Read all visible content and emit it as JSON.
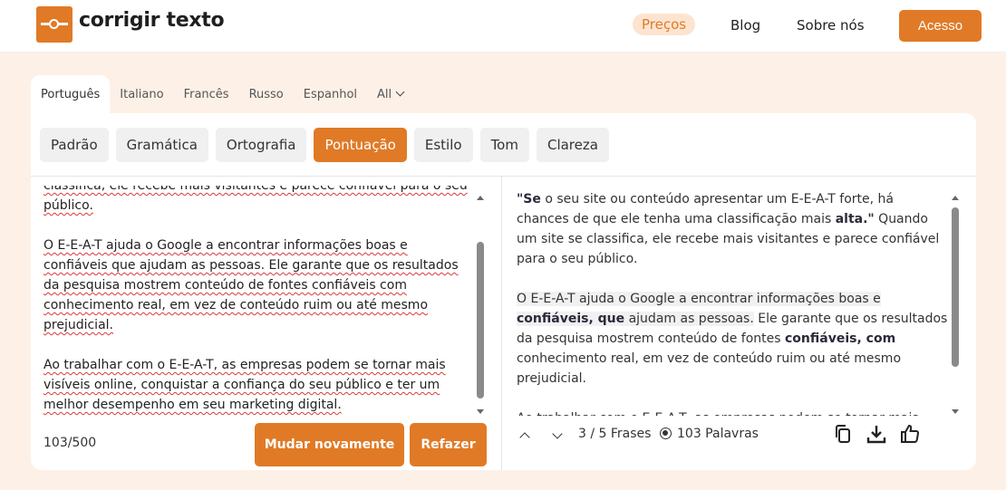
{
  "header": {
    "logo_text": "corrigir texto",
    "nav": {
      "precos": "Preços",
      "blog": "Blog",
      "sobre": "Sobre nós"
    },
    "acesso_label": "Acesso"
  },
  "languages": {
    "items": [
      "Português",
      "Italiano",
      "Francês",
      "Russo",
      "Espanhol",
      "All"
    ],
    "active": "Português"
  },
  "modes": {
    "items": [
      "Padrão",
      "Gramática",
      "Ortografia",
      "Pontuação",
      "Estilo",
      "Tom",
      "Clareza"
    ],
    "active": "Pontuação"
  },
  "input": {
    "p1_cut": "classifica, ele recebe mais visitantes e parece confiável para o seu",
    "p1_end": "público.",
    "p2": "O E-E-A-T ajuda o Google a encontrar informações boas e confiáveis que ajudam as pessoas. Ele garante que os resultados da pesquisa mostrem conteúdo de fontes confiáveis com conhecimento real, em vez de conteúdo ruim ou até mesmo prejudicial.",
    "p3": "Ao trabalhar com o E-E-A-T, as empresas podem se tornar mais visíveis online, conquistar a confiança do seu público e ter um melhor desempenho em seu marketing digital.",
    "char_count": "103/500"
  },
  "actions": {
    "mudar": "Mudar novamente",
    "refazer": "Refazer"
  },
  "output": {
    "p1_q": "\"",
    "p1_b1": "Se",
    "p1_t1": " o seu site ou conteúdo apresentar um E-E-A-T forte, há chances de que ele tenha uma classificação mais ",
    "p1_b2": "alta.\"",
    "p1_t2": " Quando um site se classifica, ele recebe mais visitantes e parece confiável para o seu público.",
    "p2_t1": "O E-E-A-T ajuda o Google a encontrar informações boas e ",
    "p2_b1": "confiáveis, que",
    "p2_t2": " ajudam as pessoas.",
    "p2_t3": " Ele garante que os resultados da pesquisa mostrem conteúdo de fontes ",
    "p2_b2": "confiáveis, com",
    "p2_t4": " conhecimento real, em vez de conteúdo ruim ou até mesmo prejudicial.",
    "p3_cut": "Ao trabalhar com o E-E-A-T, as empresas podem se tornar mais"
  },
  "footer_right": {
    "frases": "3 / 5 Frases",
    "palavras": "103 Palavras"
  },
  "colors": {
    "accent": "#e07a26",
    "page_bg": "#fdf1e7"
  }
}
